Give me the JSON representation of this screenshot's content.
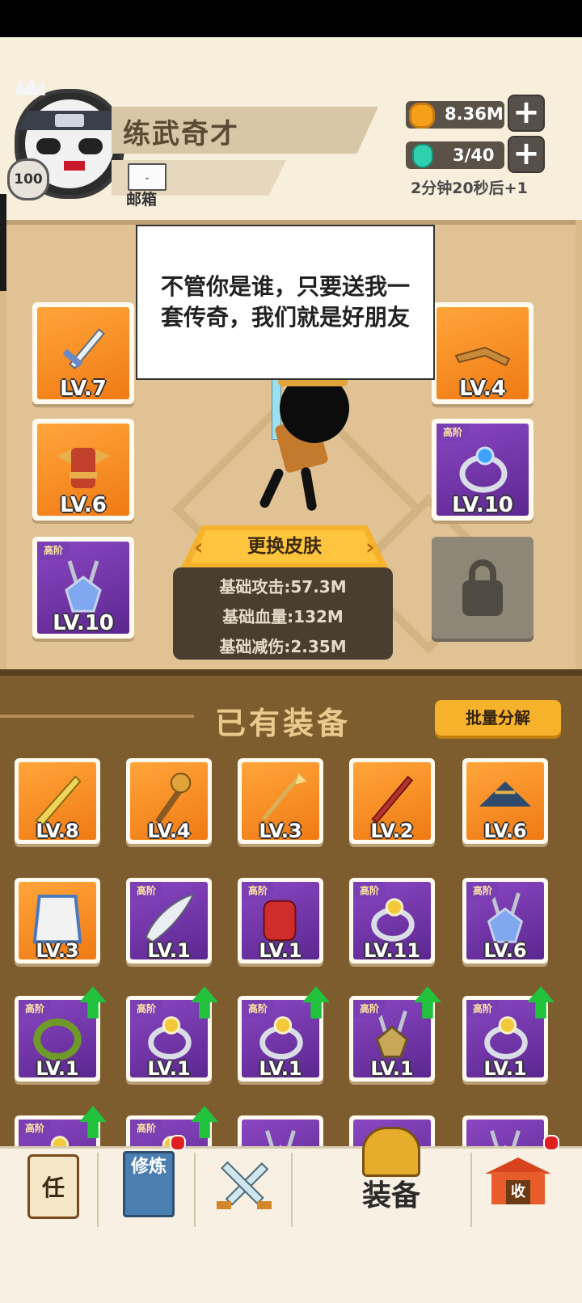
{
  "player": {
    "name": "练武奇才",
    "level": "100",
    "mail_label": "邮箱"
  },
  "resources": {
    "coins": "8.36M",
    "energy": "3/40",
    "energy_timer": "2分钟20秒后+1"
  },
  "dialog": {
    "text": "不管你是谁，只要送我一套传奇，我们就是好朋友"
  },
  "equipped": {
    "left": [
      {
        "level": "LV.7",
        "rarity": "orange",
        "icon": "sword-icon",
        "tag": ""
      },
      {
        "level": "LV.6",
        "rarity": "orange",
        "icon": "armor-icon",
        "tag": ""
      },
      {
        "level": "LV.10",
        "rarity": "purple",
        "icon": "necklace-icon",
        "tag": "高阶"
      }
    ],
    "right": [
      {
        "level": "LV.4",
        "rarity": "orange",
        "icon": "headband-icon",
        "tag": ""
      },
      {
        "level": "LV.10",
        "rarity": "purple",
        "icon": "ring-icon",
        "tag": "高阶"
      }
    ]
  },
  "skin_button": "更换皮肤",
  "stats": {
    "attack": "基础攻击:57.3M",
    "hp": "基础血量:132M",
    "reduction": "基础减伤:2.35M"
  },
  "inventory": {
    "title": "已有装备",
    "batch_button": "批量分解",
    "items": [
      {
        "level": "LV.8",
        "rarity": "orange",
        "icon": "saber-icon",
        "tag": "",
        "upgrade": false
      },
      {
        "level": "LV.4",
        "rarity": "orange",
        "icon": "mace-icon",
        "tag": "",
        "upgrade": false
      },
      {
        "level": "LV.3",
        "rarity": "orange",
        "icon": "spear-icon",
        "tag": "",
        "upgrade": false
      },
      {
        "level": "LV.2",
        "rarity": "orange",
        "icon": "staff-icon",
        "tag": "",
        "upgrade": false
      },
      {
        "level": "LV.6",
        "rarity": "orange",
        "icon": "hat-icon",
        "tag": "",
        "upgrade": false
      },
      {
        "level": "LV.3",
        "rarity": "orange",
        "icon": "robe-icon",
        "tag": "",
        "upgrade": false
      },
      {
        "level": "LV.1",
        "rarity": "purple",
        "icon": "blade-icon",
        "tag": "高阶",
        "upgrade": false
      },
      {
        "level": "LV.1",
        "rarity": "purple",
        "icon": "gauntlet-icon",
        "tag": "高阶",
        "upgrade": false
      },
      {
        "level": "LV.11",
        "rarity": "purple",
        "icon": "ring-icon",
        "tag": "高阶",
        "upgrade": false
      },
      {
        "level": "LV.6",
        "rarity": "purple",
        "icon": "necklace-icon",
        "tag": "高阶",
        "upgrade": false
      },
      {
        "level": "LV.1",
        "rarity": "purple",
        "icon": "bracelet-icon",
        "tag": "高阶",
        "upgrade": true
      },
      {
        "level": "LV.1",
        "rarity": "purple",
        "icon": "ring-icon",
        "tag": "高阶",
        "upgrade": true
      },
      {
        "level": "LV.1",
        "rarity": "purple",
        "icon": "ring-icon",
        "tag": "高阶",
        "upgrade": true
      },
      {
        "level": "LV.1",
        "rarity": "purple",
        "icon": "amulet-icon",
        "tag": "高阶",
        "upgrade": true
      },
      {
        "level": "LV.1",
        "rarity": "purple",
        "icon": "ring-icon",
        "tag": "高阶",
        "upgrade": true
      },
      {
        "level": "",
        "rarity": "purple",
        "icon": "ring-icon",
        "tag": "高阶",
        "upgrade": true
      },
      {
        "level": "",
        "rarity": "purple",
        "icon": "ring-icon",
        "tag": "高阶",
        "upgrade": true
      },
      {
        "level": "",
        "rarity": "purple",
        "icon": "necklace-icon",
        "tag": "",
        "upgrade": false
      },
      {
        "level": "",
        "rarity": "purple",
        "icon": "necklace-icon",
        "tag": "",
        "upgrade": false
      },
      {
        "level": "",
        "rarity": "purple",
        "icon": "necklace-icon",
        "tag": "",
        "upgrade": false
      }
    ]
  },
  "nav": {
    "task": "任",
    "cultivate": "修炼",
    "equip": "装备",
    "shop": "收"
  },
  "colors": {
    "orange_slot": "#f07a14",
    "purple_slot": "#5c2790",
    "upgrade_arrow": "#22c23c",
    "badge_red": "#e02020"
  }
}
